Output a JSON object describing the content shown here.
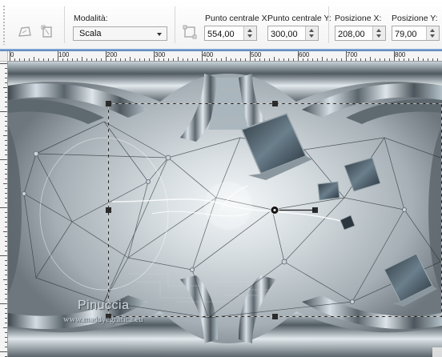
{
  "toolbar": {
    "mode_label": "Modalità:",
    "mode_value": "Scala",
    "center_x_label": "Punto centrale X:",
    "center_x_value": "554,00",
    "center_y_label": "Punto centrale Y:",
    "center_y_value": "300,00",
    "pos_x_label": "Posizione X:",
    "pos_x_value": "208,00",
    "pos_y_label": "Posizione Y:",
    "pos_y_value": "79,00",
    "icons": [
      "deform-mode-icon",
      "perspective-mode-icon",
      "reset-transform-icon"
    ]
  },
  "ruler": {
    "top_labels": [
      "0",
      "100",
      "200",
      "300",
      "400",
      "500",
      "600",
      "700",
      "800"
    ]
  },
  "canvas": {
    "watermark_title": "Pinuccia",
    "watermark_url": "www.maddyegrafica.eu"
  },
  "colors": {
    "accent_bar": "#4f7fbd",
    "handle": "#2b2b2b",
    "selection_line": "#3a3a3a"
  }
}
